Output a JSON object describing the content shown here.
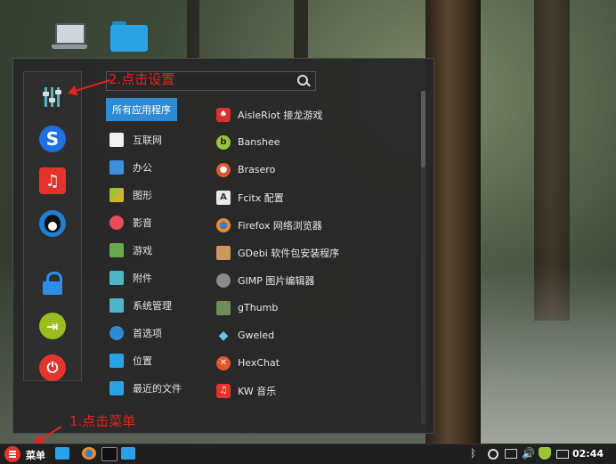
{
  "search": {
    "placeholder": ""
  },
  "annotations": {
    "step1": "1.点击菜单",
    "step2": "2.点击设置"
  },
  "sidebar": {
    "buttons": [
      {
        "name": "settings",
        "icon": "settings-sliders-icon"
      },
      {
        "name": "skype",
        "icon": "skype-icon",
        "glyph": "S"
      },
      {
        "name": "music",
        "icon": "music-note-icon",
        "glyph": "♫"
      },
      {
        "name": "qq",
        "icon": "qq-penguin-icon"
      },
      {
        "name": "lock",
        "icon": "lock-icon"
      },
      {
        "name": "logout",
        "icon": "logout-icon",
        "glyph": "⇥"
      },
      {
        "name": "power",
        "icon": "power-icon",
        "glyph": "⏻"
      }
    ]
  },
  "categories": [
    {
      "label": "所有应用程序",
      "active": true
    },
    {
      "label": "互联网",
      "color": "#f0f0f0"
    },
    {
      "label": "办公",
      "color": "#3f8ede"
    },
    {
      "label": "图形",
      "color": "#8cc43b"
    },
    {
      "label": "影音",
      "color": "#e84c5b"
    },
    {
      "label": "游戏",
      "color": "#6aa84f"
    },
    {
      "label": "附件",
      "color": "#4fb6c9"
    },
    {
      "label": "系统管理",
      "color": "#4fb6c9"
    },
    {
      "label": "首选项",
      "color": "#2f8ad4"
    },
    {
      "label": "位置",
      "color": "#29a3e6"
    },
    {
      "label": "最近的文件",
      "color": "#29a3e6"
    }
  ],
  "apps": [
    {
      "label": "AisleRiot 接龙游戏",
      "color": "#d9342b",
      "glyph": "♠"
    },
    {
      "label": "Banshee",
      "color": "#9bc43b",
      "glyph": "b"
    },
    {
      "label": "Brasero",
      "color": "#e2542d",
      "glyph": "●"
    },
    {
      "label": "Fcitx 配置",
      "color": "#e8e8e8",
      "glyph": "A"
    },
    {
      "label": "Firefox 网络浏览器",
      "color": "#f08a24",
      "glyph": "●"
    },
    {
      "label": "GDebi 软件包安装程序",
      "color": "#c99a5b",
      "glyph": "▣"
    },
    {
      "label": "GIMP 图片编辑器",
      "color": "#8a8a8a",
      "glyph": "●"
    },
    {
      "label": "gThumb",
      "color": "#6d8d5a",
      "glyph": "▣"
    },
    {
      "label": "Gweled",
      "color": "#5fc7e8",
      "glyph": "◆"
    },
    {
      "label": "HexChat",
      "color": "#e2542d",
      "glyph": "✕"
    },
    {
      "label": "KW 音乐",
      "color": "#e5332a",
      "glyph": "♫"
    }
  ],
  "taskbar": {
    "start_label": "菜单",
    "clock": "02:44"
  }
}
